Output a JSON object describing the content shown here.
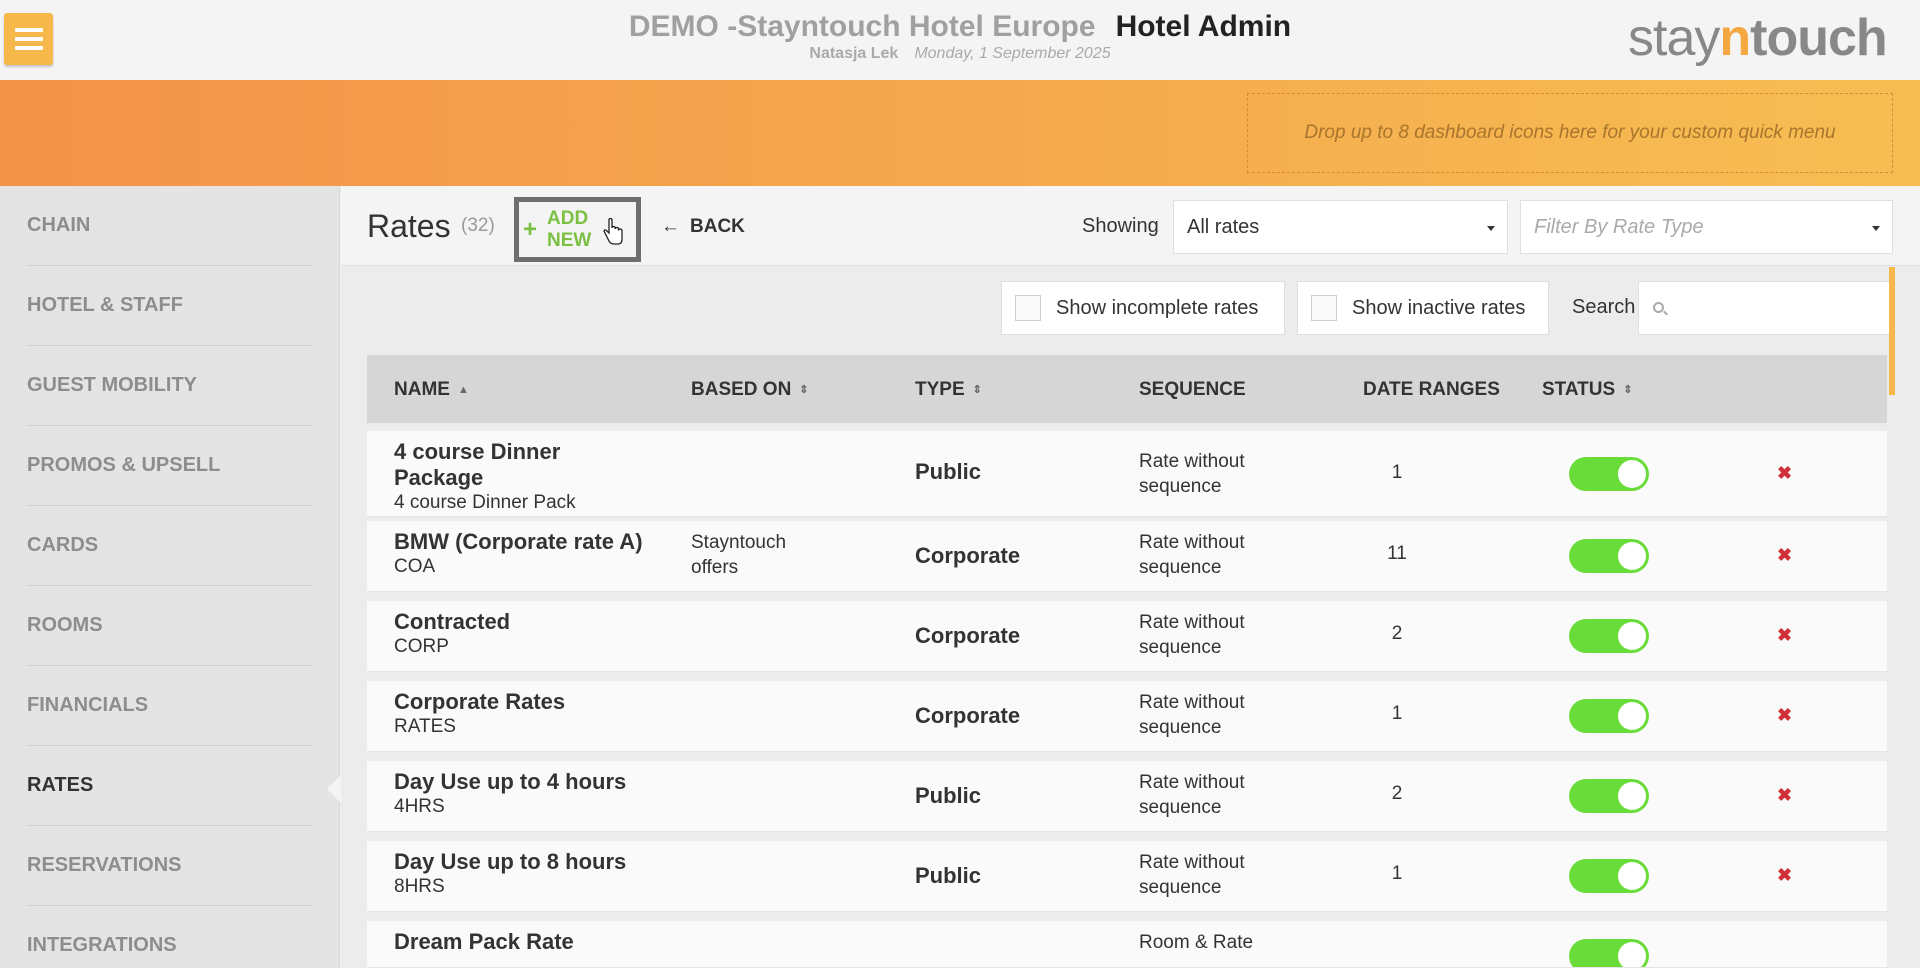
{
  "header": {
    "hotel_name": "DEMO -Stayntouch Hotel Europe",
    "section": "Hotel Admin",
    "user": "Natasja Lek",
    "date": "Monday, 1 September 2025",
    "logo": {
      "stay": "stay",
      "n": "n",
      "touch": "touch"
    }
  },
  "banner": {
    "dropzone_text": "Drop up to 8 dashboard icons here for your custom quick menu"
  },
  "sidebar": {
    "items": [
      {
        "label": "CHAIN"
      },
      {
        "label": "HOTEL & STAFF"
      },
      {
        "label": "GUEST MOBILITY"
      },
      {
        "label": "PROMOS & UPSELL"
      },
      {
        "label": "CARDS"
      },
      {
        "label": "ROOMS"
      },
      {
        "label": "FINANCIALS"
      },
      {
        "label": "RATES",
        "active": true
      },
      {
        "label": "RESERVATIONS"
      },
      {
        "label": "INTEGRATIONS"
      }
    ]
  },
  "toolbar": {
    "title": "Rates",
    "count": "(32)",
    "add_new": "ADD NEW",
    "back": "BACK",
    "showing_label": "Showing",
    "showing_value": "All rates",
    "filter_placeholder": "Filter By Rate Type"
  },
  "filters": {
    "show_incomplete": "Show incomplete rates",
    "show_inactive": "Show inactive rates",
    "search_label": "Search"
  },
  "table": {
    "columns": {
      "name": "NAME",
      "based_on": "BASED ON",
      "type": "TYPE",
      "sequence": "SEQUENCE",
      "date_ranges": "DATE RANGES",
      "status": "STATUS"
    },
    "rows": [
      {
        "name_l1": "4 course Dinner",
        "name_l2": "Package",
        "code": "4 course Dinner Pack",
        "based_l1": "",
        "based_l2": "",
        "type": "Public",
        "seq_l1": "Rate without",
        "seq_l2": "sequence",
        "date_ranges": "1",
        "active": true
      },
      {
        "name_l1": "BMW (Corporate rate A)",
        "name_l2": "",
        "code": "COA",
        "based_l1": "Stayntouch",
        "based_l2": "offers",
        "type": "Corporate",
        "seq_l1": "Rate without",
        "seq_l2": "sequence",
        "date_ranges": "11",
        "active": true
      },
      {
        "name_l1": "Contracted",
        "name_l2": "",
        "code": "CORP",
        "based_l1": "",
        "based_l2": "",
        "type": "Corporate",
        "seq_l1": "Rate without",
        "seq_l2": "sequence",
        "date_ranges": "2",
        "active": true
      },
      {
        "name_l1": "Corporate Rates",
        "name_l2": "",
        "code": "RATES",
        "based_l1": "",
        "based_l2": "",
        "type": "Corporate",
        "seq_l1": "Rate without",
        "seq_l2": "sequence",
        "date_ranges": "1",
        "active": true
      },
      {
        "name_l1": "Day Use up to 4 hours",
        "name_l2": "",
        "code": "4HRS",
        "based_l1": "",
        "based_l2": "",
        "type": "Public",
        "seq_l1": "Rate without",
        "seq_l2": "sequence",
        "date_ranges": "2",
        "active": true
      },
      {
        "name_l1": "Day Use up to 8 hours",
        "name_l2": "",
        "code": "8HRS",
        "based_l1": "",
        "based_l2": "",
        "type": "Public",
        "seq_l1": "Rate without",
        "seq_l2": "sequence",
        "date_ranges": "1",
        "active": true
      },
      {
        "name_l1": "Dream Pack Rate",
        "name_l2": "",
        "code": "",
        "based_l1": "",
        "based_l2": "",
        "type": "",
        "seq_l1": "Room & Rate",
        "seq_l2": "",
        "date_ranges": "",
        "active": true
      }
    ]
  },
  "icons": {
    "menu": "hamburger-icon",
    "add": "plus-icon",
    "back": "arrow-left-icon",
    "search": "search-icon",
    "delete": "close-icon",
    "cursor": "hand-cursor-icon"
  },
  "colors": {
    "accent_orange": "#f6b84a",
    "add_green": "#7bc043",
    "toggle_green": "#69dc3a",
    "delete_red": "#d0303a"
  }
}
